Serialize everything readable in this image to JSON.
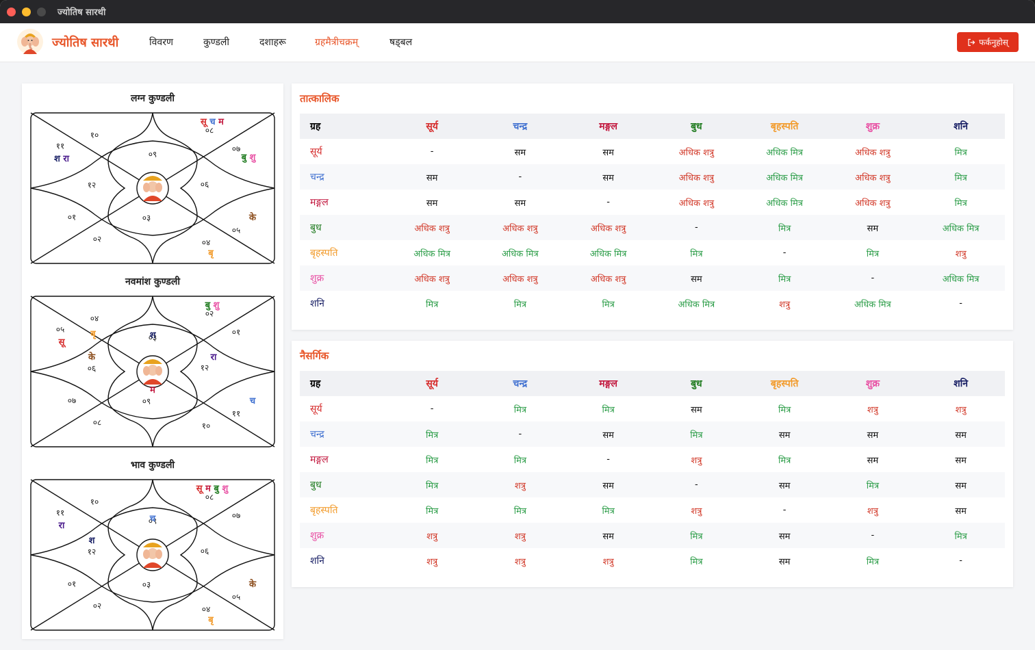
{
  "window": {
    "title": "ज्योतिष सारथी"
  },
  "header": {
    "brand": "ज्योतिष सारथी",
    "nav": [
      {
        "label": "विवरण",
        "active": false
      },
      {
        "label": "कुण्डली",
        "active": false
      },
      {
        "label": "दशाहरू",
        "active": false
      },
      {
        "label": "ग्रहमैत्रीचक्रम्",
        "active": true
      },
      {
        "label": "षड्बल",
        "active": false
      }
    ],
    "logout_label": "फर्कनुहोस्",
    "logout_icon": "logout-icon"
  },
  "colors": {
    "accent": "#e8572b",
    "su": "#d62d2d",
    "ch": "#3e6fd0",
    "ma": "#c2183e",
    "bu": "#1e7a1e",
    "br": "#f29b2b",
    "sh": "#e84fa3",
    "sa": "#1a2166",
    "ra": "#4a1a8c",
    "ke": "#8a4b1a",
    "friend": "#2e9e4a",
    "enemy": "#d23a2a",
    "neutral": "#111111"
  },
  "charts": [
    {
      "title": "लग्न कुण्डली",
      "houses": [
        {
          "num": "०९",
          "planets": []
        },
        {
          "num": "१०",
          "planets": []
        },
        {
          "num": "११",
          "planets": [
            {
              "t": "श",
              "c": "sa"
            },
            {
              "t": "रा",
              "c": "ra"
            }
          ]
        },
        {
          "num": "१२",
          "planets": []
        },
        {
          "num": "०१",
          "planets": []
        },
        {
          "num": "०२",
          "planets": []
        },
        {
          "num": "०३",
          "planets": []
        },
        {
          "num": "०४",
          "planets": [
            {
              "t": "बृ",
              "c": "br"
            }
          ]
        },
        {
          "num": "०५",
          "planets": [
            {
              "t": "के",
              "c": "ke"
            }
          ]
        },
        {
          "num": "०६",
          "planets": []
        },
        {
          "num": "०७",
          "planets": [
            {
              "t": "बु",
              "c": "bu"
            },
            {
              "t": "शु",
              "c": "sh"
            }
          ]
        },
        {
          "num": "०८",
          "planets": [
            {
              "t": "सू",
              "c": "su"
            },
            {
              "t": "च",
              "c": "ch"
            },
            {
              "t": "म",
              "c": "ma"
            }
          ]
        }
      ]
    },
    {
      "title": "नवमांश कुण्डली",
      "houses": [
        {
          "num": "०३",
          "planets": [
            {
              "t": "श",
              "c": "sa"
            }
          ]
        },
        {
          "num": "०४",
          "planets": [
            {
              "t": "बृ",
              "c": "br"
            }
          ]
        },
        {
          "num": "०५",
          "planets": [
            {
              "t": "सू",
              "c": "su"
            }
          ]
        },
        {
          "num": "०६",
          "planets": [
            {
              "t": "के",
              "c": "ke"
            }
          ]
        },
        {
          "num": "०७",
          "planets": []
        },
        {
          "num": "०८",
          "planets": []
        },
        {
          "num": "०९",
          "planets": [
            {
              "t": "म",
              "c": "ma"
            }
          ]
        },
        {
          "num": "१०",
          "planets": []
        },
        {
          "num": "११",
          "planets": [
            {
              "t": "च",
              "c": "ch"
            }
          ]
        },
        {
          "num": "१२",
          "planets": [
            {
              "t": "रा",
              "c": "ra"
            }
          ]
        },
        {
          "num": "०१",
          "planets": []
        },
        {
          "num": "०२",
          "planets": [
            {
              "t": "बु",
              "c": "bu"
            },
            {
              "t": "शु",
              "c": "sh"
            }
          ]
        }
      ]
    },
    {
      "title": "भाव कुण्डली",
      "houses": [
        {
          "num": "०९",
          "planets": [
            {
              "t": "च",
              "c": "ch"
            }
          ]
        },
        {
          "num": "१०",
          "planets": []
        },
        {
          "num": "११",
          "planets": [
            {
              "t": "रा",
              "c": "ra"
            }
          ]
        },
        {
          "num": "१२",
          "planets": [
            {
              "t": "श",
              "c": "sa"
            }
          ]
        },
        {
          "num": "०१",
          "planets": []
        },
        {
          "num": "०२",
          "planets": []
        },
        {
          "num": "०३",
          "planets": []
        },
        {
          "num": "०४",
          "planets": [
            {
              "t": "बृ",
              "c": "br"
            }
          ]
        },
        {
          "num": "०५",
          "planets": [
            {
              "t": "के",
              "c": "ke"
            }
          ]
        },
        {
          "num": "०६",
          "planets": []
        },
        {
          "num": "०७",
          "planets": []
        },
        {
          "num": "०८",
          "planets": [
            {
              "t": "सू",
              "c": "su"
            },
            {
              "t": "म",
              "c": "ma"
            },
            {
              "t": "बु",
              "c": "bu"
            },
            {
              "t": "शु",
              "c": "sh"
            }
          ]
        }
      ]
    }
  ],
  "tables": [
    {
      "title": "तात्कालिक",
      "corner": "ग्रह",
      "planets": [
        {
          "name": "सूर्य",
          "c": "su"
        },
        {
          "name": "चन्द्र",
          "c": "ch"
        },
        {
          "name": "मङ्गल",
          "c": "ma"
        },
        {
          "name": "बुध",
          "c": "bu"
        },
        {
          "name": "बृहस्पति",
          "c": "br"
        },
        {
          "name": "शुक्र",
          "c": "sh"
        },
        {
          "name": "शनि",
          "c": "sa"
        }
      ],
      "rows": [
        [
          "-",
          "सम",
          "सम",
          "अधिक शत्रु",
          "अधिक मित्र",
          "अधिक शत्रु",
          "मित्र"
        ],
        [
          "सम",
          "-",
          "सम",
          "अधिक शत्रु",
          "अधिक मित्र",
          "अधिक शत्रु",
          "मित्र"
        ],
        [
          "सम",
          "सम",
          "-",
          "अधिक शत्रु",
          "अधिक मित्र",
          "अधिक शत्रु",
          "मित्र"
        ],
        [
          "अधिक शत्रु",
          "अधिक शत्रु",
          "अधिक शत्रु",
          "-",
          "मित्र",
          "सम",
          "अधिक मित्र"
        ],
        [
          "अधिक मित्र",
          "अधिक मित्र",
          "अधिक मित्र",
          "मित्र",
          "-",
          "मित्र",
          "शत्रु"
        ],
        [
          "अधिक शत्रु",
          "अधिक शत्रु",
          "अधिक शत्रु",
          "सम",
          "मित्र",
          "-",
          "अधिक मित्र"
        ],
        [
          "मित्र",
          "मित्र",
          "मित्र",
          "अधिक मित्र",
          "शत्रु",
          "अधिक मित्र",
          "-"
        ]
      ]
    },
    {
      "title": "नैसर्गिक",
      "corner": "ग्रह",
      "planets": [
        {
          "name": "सूर्य",
          "c": "su"
        },
        {
          "name": "चन्द्र",
          "c": "ch"
        },
        {
          "name": "मङ्गल",
          "c": "ma"
        },
        {
          "name": "बुध",
          "c": "bu"
        },
        {
          "name": "बृहस्पति",
          "c": "br"
        },
        {
          "name": "शुक्र",
          "c": "sh"
        },
        {
          "name": "शनि",
          "c": "sa"
        }
      ],
      "rows": [
        [
          "-",
          "मित्र",
          "मित्र",
          "सम",
          "मित्र",
          "शत्रु",
          "शत्रु"
        ],
        [
          "मित्र",
          "-",
          "सम",
          "मित्र",
          "सम",
          "सम",
          "सम"
        ],
        [
          "मित्र",
          "मित्र",
          "-",
          "शत्रु",
          "मित्र",
          "सम",
          "सम"
        ],
        [
          "मित्र",
          "शत्रु",
          "सम",
          "-",
          "सम",
          "मित्र",
          "सम"
        ],
        [
          "मित्र",
          "मित्र",
          "मित्र",
          "शत्रु",
          "-",
          "शत्रु",
          "सम"
        ],
        [
          "शत्रु",
          "शत्रु",
          "सम",
          "मित्र",
          "सम",
          "-",
          "मित्र"
        ],
        [
          "शत्रु",
          "शत्रु",
          "शत्रु",
          "मित्र",
          "सम",
          "मित्र",
          "-"
        ]
      ]
    }
  ]
}
